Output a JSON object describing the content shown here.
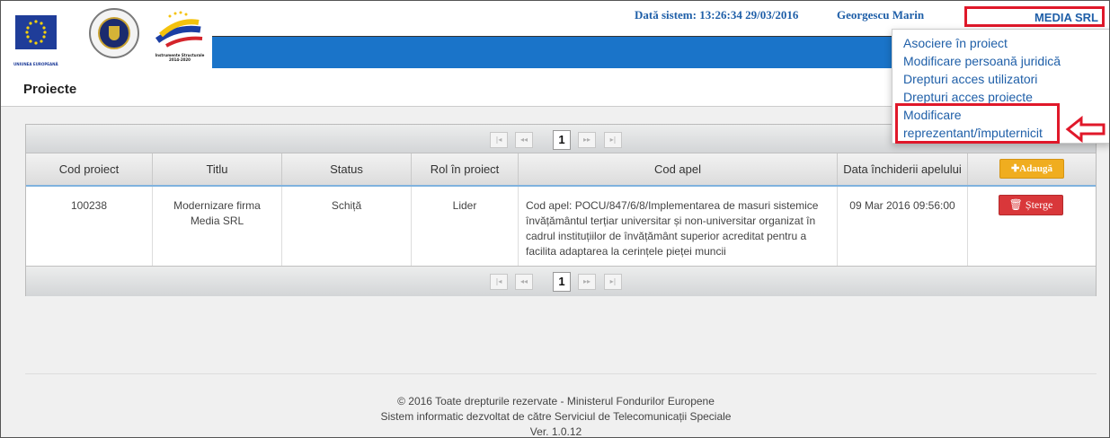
{
  "header": {
    "eu_label": "UNIUNEA EUROPEANĂ",
    "is_label_line1": "Instrumente Structurale",
    "is_label_line2": "2014-2020",
    "system_time": "Dată sistem: 13:26:34 29/03/2016",
    "user_name": "Georgescu Marin",
    "company": "MEDIA SRL",
    "accent_color": "#1a74c9",
    "highlight_color": "#e0182a"
  },
  "page": {
    "title": "Proiecte"
  },
  "menu": {
    "items": [
      "Asociere în proiect",
      "Modificare persoană juridică",
      "Drepturi acces utilizatori",
      "Drepturi acces proiecte",
      "Modificare",
      "reprezentant/împuternicit"
    ]
  },
  "pager": {
    "first": "|◂",
    "prev": "◂◂",
    "current": "1",
    "next": "▸▸",
    "last": "▸|"
  },
  "table": {
    "columns": [
      "Cod proiect",
      "Titlu",
      "Status",
      "Rol în proiect",
      "Cod apel",
      "Data închiderii apelului"
    ],
    "add_label": "✚Adaugă",
    "rows": [
      {
        "cod": "100238",
        "titlu": "Modernizare firma Media SRL",
        "status": "Schiță",
        "rol": "Lider",
        "cod_apel": "Cod apel: POCU/847/6/8/Implementarea de masuri sistemice învățământul terțiar universitar și non-universitar organizat în cadrul instituțiilor de învățământ superior acreditat pentru a facilita adaptarea la cerințele pieței muncii",
        "data": "09 Mar 2016 09:56:00",
        "delete_label": "🗑 Șterge"
      }
    ]
  },
  "footer": {
    "line1": "© 2016 Toate drepturile rezervate - Ministerul Fondurilor Europene",
    "line2": "Sistem informatic dezvoltat de către Serviciul de Telecomunicații Speciale",
    "line3": "Ver. 1.0.12"
  }
}
